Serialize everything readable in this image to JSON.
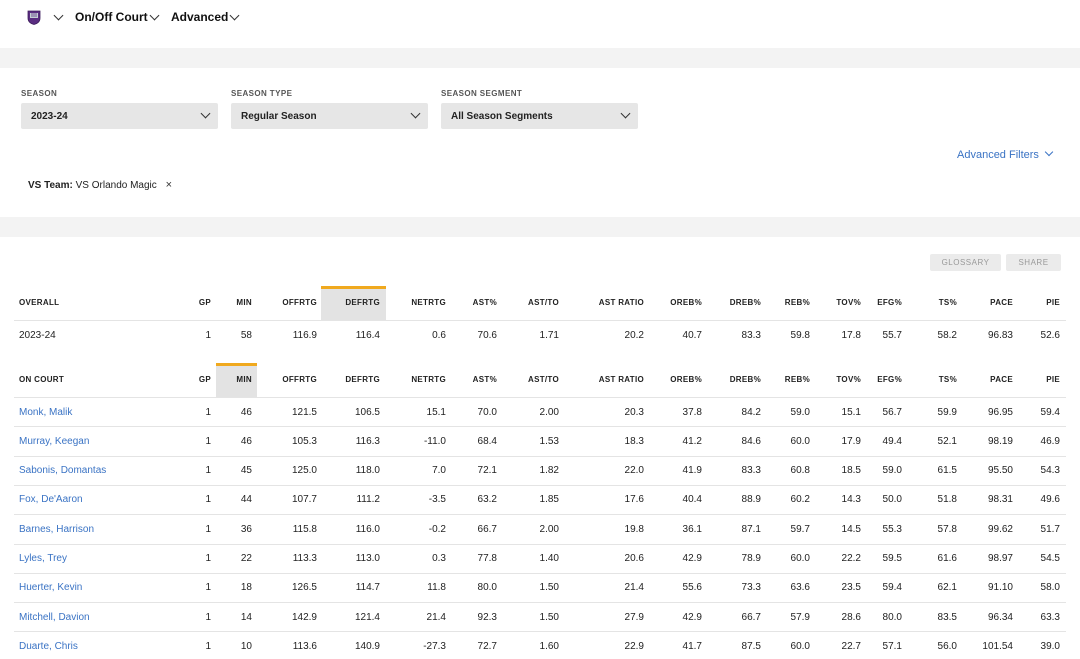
{
  "topbar": {
    "view_label": "On/Off Court",
    "measure_label": "Advanced"
  },
  "filters": [
    {
      "label": "SEASON",
      "value": "2023-24"
    },
    {
      "label": "SEASON TYPE",
      "value": "Regular Season"
    },
    {
      "label": "SEASON SEGMENT",
      "value": "All Season Segments"
    }
  ],
  "advanced_filters_label": "Advanced Filters",
  "active_filter": {
    "key": "VS Team:",
    "value": "VS Orlando Magic",
    "close": "×"
  },
  "buttons": {
    "glossary": "GLOSSARY",
    "share": "SHARE"
  },
  "overall": {
    "headers": [
      "OVERALL",
      "GP",
      "MIN",
      "OFFRTG",
      "DEFRTG",
      "NETRTG",
      "AST%",
      "AST/TO",
      "AST RATIO",
      "OREB%",
      "DREB%",
      "REB%",
      "TOV%",
      "EFG%",
      "TS%",
      "PACE",
      "PIE"
    ],
    "rows": [
      [
        "2023-24",
        "1",
        "58",
        "116.9",
        "116.4",
        "0.6",
        "70.6",
        "1.71",
        "20.2",
        "40.7",
        "83.3",
        "59.8",
        "17.8",
        "55.7",
        "58.2",
        "96.83",
        "52.6"
      ]
    ]
  },
  "on_court": {
    "headers": [
      "ON COURT",
      "GP",
      "MIN",
      "OFFRTG",
      "DEFRTG",
      "NETRTG",
      "AST%",
      "AST/TO",
      "AST RATIO",
      "OREB%",
      "DREB%",
      "REB%",
      "TOV%",
      "EFG%",
      "TS%",
      "PACE",
      "PIE"
    ],
    "rows": [
      [
        "Monk, Malik",
        "1",
        "46",
        "121.5",
        "106.5",
        "15.1",
        "70.0",
        "2.00",
        "20.3",
        "37.8",
        "84.2",
        "59.0",
        "15.1",
        "56.7",
        "59.9",
        "96.95",
        "59.4"
      ],
      [
        "Murray, Keegan",
        "1",
        "46",
        "105.3",
        "116.3",
        "-11.0",
        "68.4",
        "1.53",
        "18.3",
        "41.2",
        "84.6",
        "60.0",
        "17.9",
        "49.4",
        "52.1",
        "98.19",
        "46.9"
      ],
      [
        "Sabonis, Domantas",
        "1",
        "45",
        "125.0",
        "118.0",
        "7.0",
        "72.1",
        "1.82",
        "22.0",
        "41.9",
        "83.3",
        "60.8",
        "18.5",
        "59.0",
        "61.5",
        "95.50",
        "54.3"
      ],
      [
        "Fox, De'Aaron",
        "1",
        "44",
        "107.7",
        "111.2",
        "-3.5",
        "63.2",
        "1.85",
        "17.6",
        "40.4",
        "88.9",
        "60.2",
        "14.3",
        "50.0",
        "51.8",
        "98.31",
        "49.6"
      ],
      [
        "Barnes, Harrison",
        "1",
        "36",
        "115.8",
        "116.0",
        "-0.2",
        "66.7",
        "2.00",
        "19.8",
        "36.1",
        "87.1",
        "59.7",
        "14.5",
        "55.3",
        "57.8",
        "99.62",
        "51.7"
      ],
      [
        "Lyles, Trey",
        "1",
        "22",
        "113.3",
        "113.0",
        "0.3",
        "77.8",
        "1.40",
        "20.6",
        "42.9",
        "78.9",
        "60.0",
        "22.2",
        "59.5",
        "61.6",
        "98.97",
        "54.5"
      ],
      [
        "Huerter, Kevin",
        "1",
        "18",
        "126.5",
        "114.7",
        "11.8",
        "80.0",
        "1.50",
        "21.4",
        "55.6",
        "73.3",
        "63.6",
        "23.5",
        "59.4",
        "62.1",
        "91.10",
        "58.0"
      ],
      [
        "Mitchell, Davion",
        "1",
        "14",
        "142.9",
        "121.4",
        "21.4",
        "92.3",
        "1.50",
        "27.9",
        "42.9",
        "66.7",
        "57.9",
        "28.6",
        "80.0",
        "83.5",
        "96.34",
        "63.3"
      ],
      [
        "Duarte, Chris",
        "1",
        "10",
        "113.6",
        "140.9",
        "-27.3",
        "72.7",
        "1.60",
        "22.9",
        "41.7",
        "87.5",
        "60.0",
        "22.7",
        "57.1",
        "56.0",
        "101.54",
        "39.0"
      ]
    ]
  },
  "colors": {
    "accent": "#f0a91e",
    "link": "#3a73c4",
    "band": "#f3f3f3"
  }
}
